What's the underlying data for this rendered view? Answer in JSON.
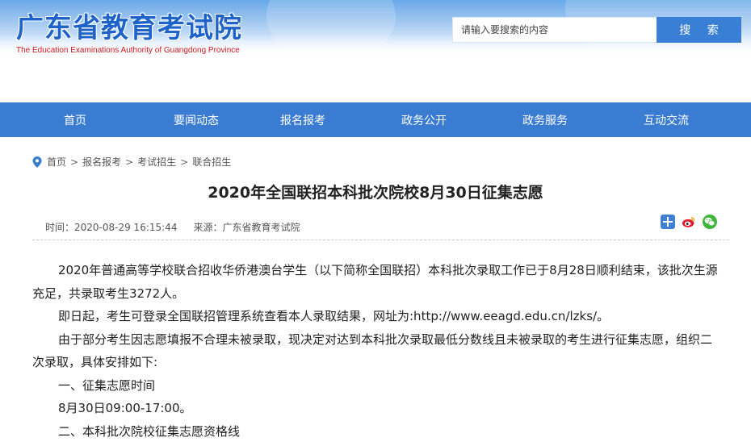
{
  "header": {
    "title": "广东省教育考试院",
    "subtitle": "The Education Examinations Authority of Guangdong Province",
    "search_placeholder": "请输入要搜索的内容",
    "search_button": "搜 索",
    "colors": {
      "brand_blue": "#1d63c9",
      "subtitle_red": "#d0191f",
      "button_blue": "#3a7fd6"
    }
  },
  "nav": {
    "items": [
      {
        "label": "首页"
      },
      {
        "label": "要闻动态"
      },
      {
        "label": "报名报考"
      },
      {
        "label": "政务公开"
      },
      {
        "label": "政务服务"
      },
      {
        "label": "互动交流"
      }
    ],
    "background": "#3b7cd3"
  },
  "breadcrumb": {
    "icon": "location-pin-icon",
    "items": [
      "首页",
      "报名报考",
      "考试招生",
      "联合招生"
    ],
    "separator": ">"
  },
  "article": {
    "title": "2020年全国联招本科批次院校8月30日征集志愿",
    "time": "时间：2020-08-29 16:15:44",
    "source": "来源：广东省教育考试院",
    "share_icons": [
      "plus-share-icon",
      "weibo-icon",
      "wechat-icon"
    ],
    "paragraphs": [
      "2020年普通高等学校联合招收华侨港澳台学生（以下简称全国联招）本科批次录取工作已于8月28日顺利结束，该批次生源充足，共录取考生3272人。",
      "即日起，考生可登录全国联招管理系统查看本人录取结果，网址为:http://www.eeagd.edu.cn/lzks/。",
      "由于部分考生因志愿填报不合理未被录取，现决定对达到本科批次录取最低分数线且未被录取的考生进行征集志愿，组织二次录取，具体安排如下:",
      "一、征集志愿时间",
      "8月30日09:00-17:00。",
      "二、本科批次院校征集志愿资格线"
    ]
  }
}
